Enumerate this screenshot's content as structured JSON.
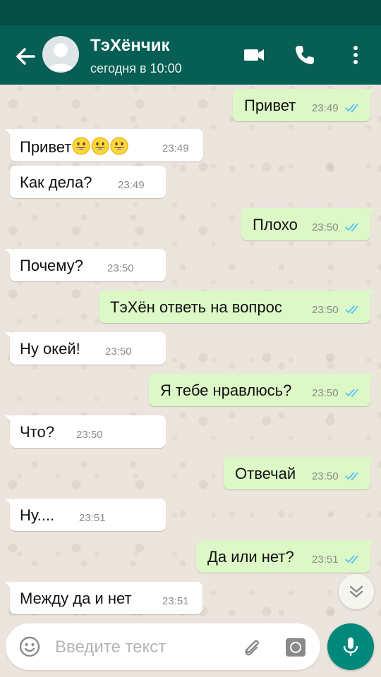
{
  "header": {
    "contact_name": "ТэХёнчик",
    "status": "сегодня в 10:00"
  },
  "messages": [
    {
      "dir": "out",
      "text": "Привет",
      "time": "23:49",
      "read": true
    },
    {
      "dir": "in",
      "text": "Привет",
      "emoji": "grinning-face x3",
      "time": "23:49"
    },
    {
      "dir": "in",
      "text": "Как дела?",
      "time": "23:49"
    },
    {
      "dir": "out",
      "text": "Плохо",
      "time": "23:50",
      "read": true
    },
    {
      "dir": "in",
      "text": "Почему?",
      "time": "23:50"
    },
    {
      "dir": "out",
      "text": "ТэХён ответь на вопрос",
      "time": "23:50",
      "read": true
    },
    {
      "dir": "in",
      "text": "Ну окей!",
      "time": "23:50"
    },
    {
      "dir": "out",
      "text": "Я тебе нравлюсь?",
      "time": "23:50",
      "read": true
    },
    {
      "dir": "in",
      "text": "Что?",
      "time": "23:50"
    },
    {
      "dir": "out",
      "text": "Отвечай",
      "time": "23:50",
      "read": true
    },
    {
      "dir": "in",
      "text": "Ну....",
      "time": "23:51"
    },
    {
      "dir": "out",
      "text": "Да или нет?",
      "time": "23:51",
      "read": true
    },
    {
      "dir": "in",
      "text": "Между да и нет",
      "time": "23:51"
    }
  ],
  "composer": {
    "placeholder": "Введите текст"
  },
  "icons": {
    "back": "arrow-left-icon",
    "video": "video-camera-icon",
    "phone": "phone-icon",
    "more": "more-vertical-icon",
    "emoji": "smiley-icon",
    "attach": "paperclip-icon",
    "camera": "camera-icon",
    "mic": "microphone-icon",
    "scroll": "double-chevron-down-icon",
    "read_ticks": "double-check-icon"
  },
  "colors": {
    "header": "#075e54",
    "statusbar": "#054d44",
    "outgoing_bubble": "#dcf8c6",
    "incoming_bubble": "#ffffff",
    "read_ticks": "#4fc3f7",
    "mic_button": "#00897b",
    "chat_background": "#ece5dd"
  }
}
